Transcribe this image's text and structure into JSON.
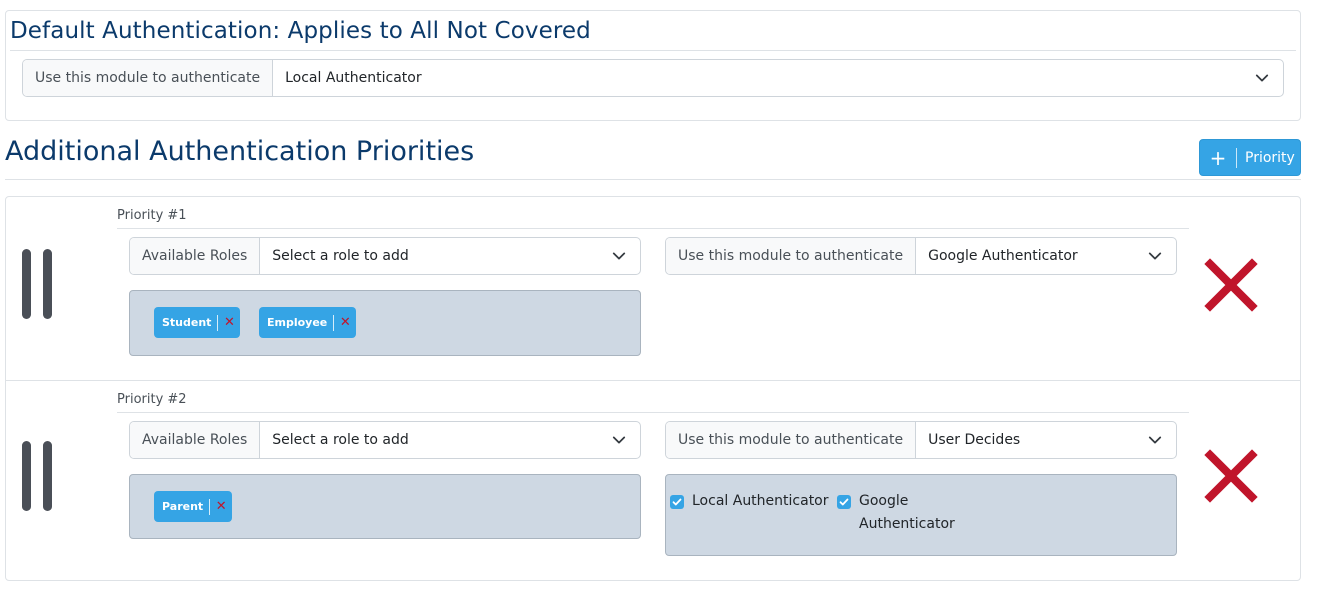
{
  "default_section": {
    "title": "Default Authentication: Applies to All Not Covered",
    "module_label": "Use this module to authenticate",
    "module_value": "Local Authenticator"
  },
  "additional_section": {
    "title": "Additional Authentication Priorities",
    "add_button_icon": "+",
    "add_button_label": "Priority"
  },
  "priorities": [
    {
      "label": "Priority #1",
      "roles_label": "Available Roles",
      "roles_placeholder": "Select a role to add",
      "roles": [
        "Student",
        "Employee"
      ],
      "module_label": "Use this module to authenticate",
      "module_value": "Google Authenticator",
      "authenticators": []
    },
    {
      "label": "Priority #2",
      "roles_label": "Available Roles",
      "roles_placeholder": "Select a role to add",
      "roles": [
        "Parent"
      ],
      "module_label": "Use this module to authenticate",
      "module_value": "User Decides",
      "authenticators": [
        {
          "line1": "Local Authenticator",
          "line2": "",
          "checked": true
        },
        {
          "line1": "Google",
          "line2": "Authenticator",
          "checked": true
        }
      ]
    }
  ],
  "chip_remove_glyph": "✕",
  "icons": {
    "drag": "drag-handle-icon",
    "remove": "close-x-icon",
    "dropdown": "chevron-down-icon",
    "check": "checkmark-icon"
  },
  "colors": {
    "heading": "#0b3a6b",
    "accent": "#35a4e5",
    "danger": "#c0152b",
    "box_fill": "#ced8e3"
  }
}
